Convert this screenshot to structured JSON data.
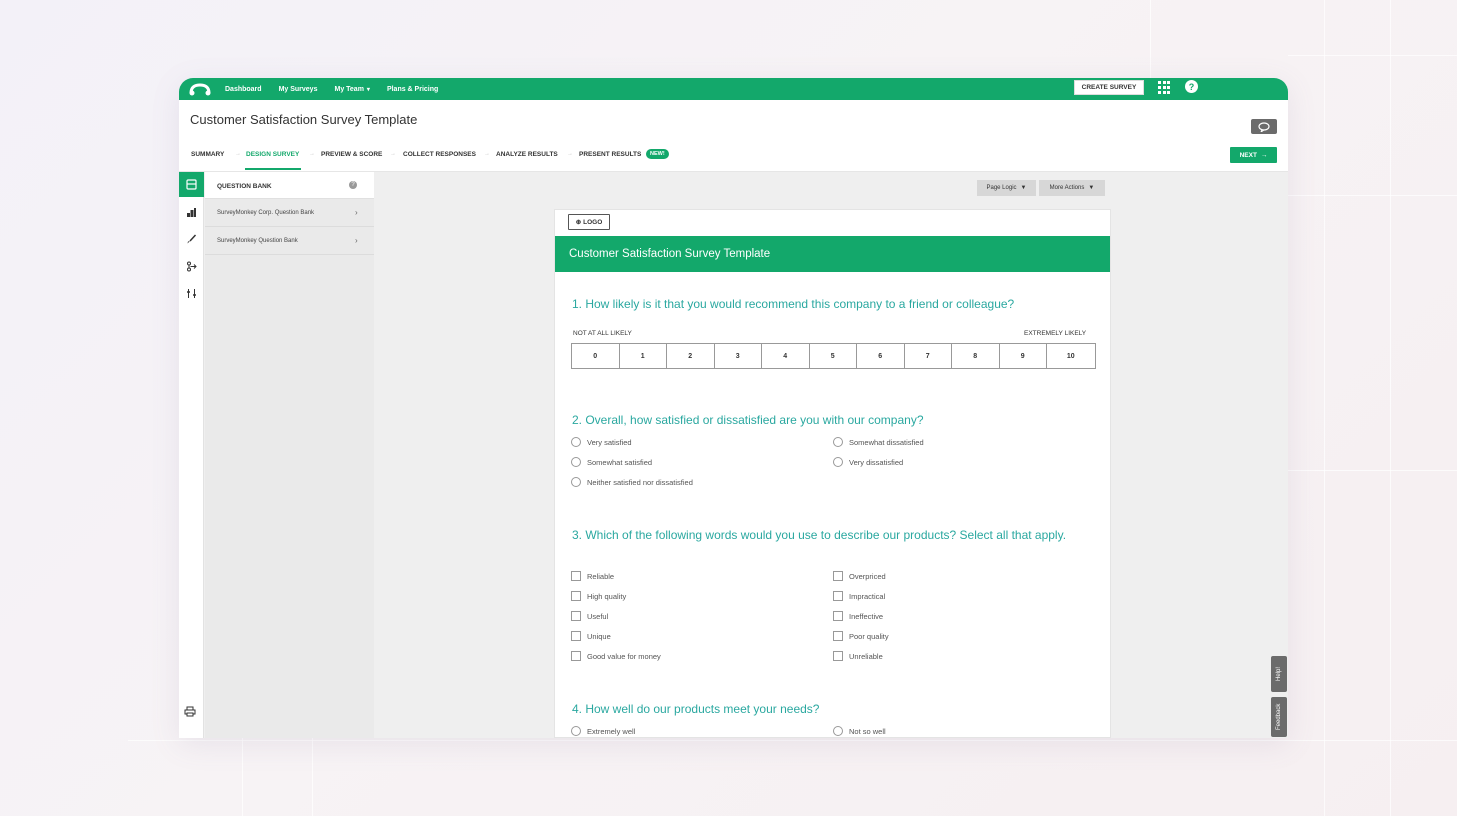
{
  "nav": {
    "links": [
      "Dashboard",
      "My Surveys",
      "My Team",
      "Plans & Pricing"
    ],
    "create_survey": "CREATE SURVEY"
  },
  "page_title": "Customer Satisfaction Survey Template",
  "tabs": {
    "summary": "SUMMARY",
    "design": "DESIGN SURVEY",
    "preview": "PREVIEW & SCORE",
    "collect": "COLLECT RESPONSES",
    "analyze": "ANALYZE RESULTS",
    "present": "PRESENT RESULTS",
    "new_badge": "NEW!",
    "next": "NEXT"
  },
  "panel": {
    "title": "QUESTION BANK",
    "items": [
      "SurveyMonkey Corp. Question Bank",
      "SurveyMonkey Question Bank"
    ]
  },
  "toolbar": {
    "page_logic": "Page Logic",
    "more_actions": "More Actions"
  },
  "survey": {
    "logo_label": "LOGO",
    "banner_title": "Customer Satisfaction Survey Template",
    "q1": {
      "text": "1. How likely is it that you would recommend this company to a friend or colleague?",
      "low_label": "NOT AT ALL LIKELY",
      "high_label": "EXTREMELY LIKELY",
      "scale": [
        "0",
        "1",
        "2",
        "3",
        "4",
        "5",
        "6",
        "7",
        "8",
        "9",
        "10"
      ]
    },
    "q2": {
      "text": "2. Overall, how satisfied or dissatisfied are you with our company?",
      "options": [
        "Very satisfied",
        "Somewhat satisfied",
        "Neither satisfied nor dissatisfied",
        "Somewhat dissatisfied",
        "Very dissatisfied"
      ]
    },
    "q3": {
      "text": "3. Which of the following words would you use to describe our products? Select all that apply.",
      "options": [
        "Reliable",
        "High quality",
        "Useful",
        "Unique",
        "Good value for money",
        "Overpriced",
        "Impractical",
        "Ineffective",
        "Poor quality",
        "Unreliable"
      ]
    },
    "q4": {
      "text": "4. How well do our products meet your needs?",
      "options": [
        "Extremely well",
        "Not so well"
      ]
    }
  },
  "side_tabs": {
    "help": "Help!",
    "feedback": "Feedback"
  },
  "colors": {
    "brand": "#13a86b",
    "question": "#2aa8a0"
  }
}
